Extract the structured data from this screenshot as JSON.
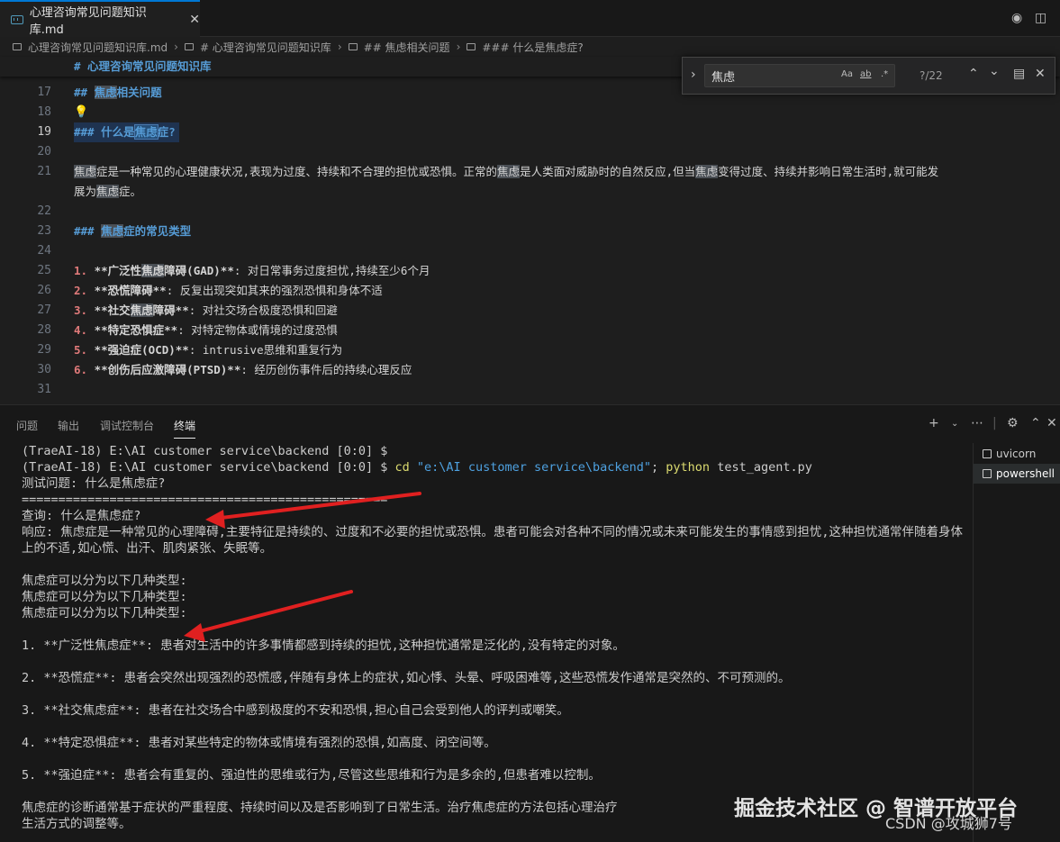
{
  "tab": {
    "title": "心理咨询常见问题知识库.md",
    "close": "✕"
  },
  "breadcrumb": [
    "心理咨询常见问题知识库.md",
    "# 心理咨询常见问题知识库",
    "## 焦虑相关问题",
    "### 什么是焦虑症?"
  ],
  "editor": {
    "sticky": "# 心理咨询常见问题知识库",
    "lines": {
      "l17": {
        "no": "17",
        "mark": "## ",
        "pre": "",
        "hl": "焦虑",
        "post": "相关问题"
      },
      "l18": {
        "no": "18",
        "bulb": "💡"
      },
      "l19": {
        "no": "19",
        "mark": "### ",
        "pre": "什么是",
        "hl": "焦虑",
        "post": "症?"
      },
      "l20": {
        "no": "20"
      },
      "l21": {
        "no": "21",
        "segs": [
          "焦虑",
          "症是一种常见的心理健康状况,表现为过度、持续和不合理的担忧或恐惧。正常的",
          "焦虑",
          "是人类面对威胁时的自然反应,但当",
          "焦虑",
          "变得过度、持续并影响日常生活时,就可能发"
        ],
        "wrap_pre": "展为",
        "wrap_hl": "焦虑",
        "wrap_post": "症。"
      },
      "l22": {
        "no": "22"
      },
      "l23": {
        "no": "23",
        "mark": "### ",
        "pre": "",
        "hl": "焦虑",
        "post": "症的常见类型"
      },
      "l24": {
        "no": "24"
      },
      "l25": {
        "no": "25",
        "num": "1.",
        "b_pre": "**广泛性",
        "b_hl": "焦虑",
        "b_post": "障碍(GAD)**",
        "rest": ": 对日常事务过度担忧,持续至少6个月"
      },
      "l26": {
        "no": "26",
        "num": "2.",
        "b_pre": "**恐慌障碍**",
        "b_hl": "",
        "b_post": "",
        "rest": ": 反复出现突如其来的强烈恐惧和身体不适"
      },
      "l27": {
        "no": "27",
        "num": "3.",
        "b_pre": "**社交",
        "b_hl": "焦虑",
        "b_post": "障碍**",
        "rest": ": 对社交场合极度恐惧和回避"
      },
      "l28": {
        "no": "28",
        "num": "4.",
        "b_pre": "**特定恐惧症**",
        "b_hl": "",
        "b_post": "",
        "rest": ": 对特定物体或情境的过度恐惧"
      },
      "l29": {
        "no": "29",
        "num": "5.",
        "b_pre": "**强迫症(OCD)**",
        "b_hl": "",
        "b_post": "",
        "rest": ":  intrusive思维和重复行为"
      },
      "l30": {
        "no": "30",
        "num": "6.",
        "b_pre": "**创伤后应激障碍(PTSD)**",
        "b_hl": "",
        "b_post": "",
        "rest": ": 经历创伤事件后的持续心理反应"
      },
      "l31": {
        "no": "31"
      }
    }
  },
  "find": {
    "query": "焦虑",
    "count": "?/22",
    "opt_case": "Aa",
    "opt_word": "ab",
    "opt_regex": ".*"
  },
  "panel": {
    "tabs": [
      "问题",
      "输出",
      "调试控制台",
      "终端"
    ],
    "terminals": [
      "uvicorn",
      "powershell"
    ]
  },
  "terminal": {
    "l1": "(TraeAI-18) E:\\AI customer service\\backend [0:0] $",
    "l2_prompt": "(TraeAI-18) E:\\AI customer service\\backend [0:0] $ ",
    "l2_cmd": "cd",
    "l2_str": "\"e:\\AI customer service\\backend\"",
    "l2_sep": "; ",
    "l2_py": "python",
    "l2_arg": " test_agent.py",
    "l3": "测试问题: 什么是焦虑症?",
    "l4": "==================================================",
    "l5": "查询: 什么是焦虑症?",
    "l6": "响应: 焦虑症是一种常见的心理障碍,主要特征是持续的、过度和不必要的担忧或恐惧。患者可能会对各种不同的情况或未来可能发生的事情感到担忧,这种担忧通常伴随着身体上的不适,如心慌、出汗、肌肉紧张、失眠等。",
    "l7": "焦虑症可以分为以下几种类型:",
    "l8": "焦虑症可以分为以下几种类型:",
    "l9": "焦虑症可以分为以下几种类型:",
    "items": [
      "1. **广泛性焦虑症**: 患者对生活中的许多事情都感到持续的担忧,这种担忧通常是泛化的,没有特定的对象。",
      "2. **恐慌症**: 患者会突然出现强烈的恐慌感,伴随有身体上的症状,如心悸、头晕、呼吸困难等,这些恐慌发作通常是突然的、不可预测的。",
      "3. **社交焦虑症**: 患者在社交场合中感到极度的不安和恐惧,担心自己会受到他人的评判或嘲笑。",
      "4. **特定恐惧症**: 患者对某些特定的物体或情境有强烈的恐惧,如高度、闭空间等。",
      "5. **强迫症**: 患者会有重复的、强迫性的思维或行为,尽管这些思维和行为是多余的,但患者难以控制。"
    ],
    "l_last": "焦虑症的诊断通常基于症状的严重程度、持续时间以及是否影响到了日常生活。治疗焦虑症的方法包括心理治疗",
    "l_last2": "生活方式的调整等。"
  },
  "watermark": {
    "line1": "掘金技术社区 @ 智谱开放平台",
    "line2": "CSDN @攻城狮7号"
  },
  "colors": {
    "accent": "#0078d4",
    "heading": "#569cd6",
    "highlight": "#4a4f55",
    "arrow": "#e02020"
  }
}
